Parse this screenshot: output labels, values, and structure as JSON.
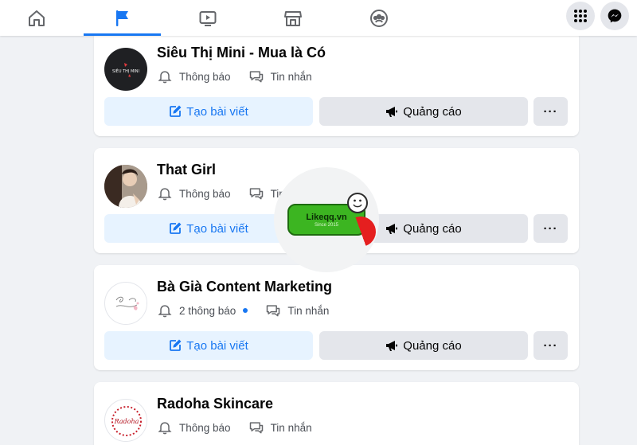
{
  "nav": {
    "tabs": [
      {
        "icon": "home-icon",
        "active": false
      },
      {
        "icon": "flag-icon",
        "active": true
      },
      {
        "icon": "video-icon",
        "active": false
      },
      {
        "icon": "marketplace-icon",
        "active": false
      },
      {
        "icon": "groups-icon",
        "active": false
      }
    ],
    "right": [
      {
        "icon": "menu-grid-icon"
      },
      {
        "icon": "messenger-icon"
      }
    ]
  },
  "colors": {
    "accent": "#1877f2",
    "create_bg": "#e7f3ff",
    "secondary_bg": "#e4e6eb",
    "page_bg": "#f0f2f5"
  },
  "pages": [
    {
      "name": "Siêu Thị Mini - Mua là Có",
      "avatar_text": "SIÊU THỊ MINI",
      "notifications": "Thông báo",
      "messages": "Tin nhắn",
      "has_dot": false,
      "create_label": "Tạo bài viết",
      "ads_label": "Quảng cáo",
      "more_label": "···"
    },
    {
      "name": "That Girl",
      "avatar_text": "",
      "notifications": "Thông báo",
      "messages": "Tin nhắn",
      "has_dot": false,
      "create_label": "Tạo bài viết",
      "ads_label": "Quảng cáo",
      "more_label": "···"
    },
    {
      "name": "Bà Già Content Marketing",
      "avatar_text": "",
      "notifications": "2 thông báo",
      "messages": "Tin nhắn",
      "has_dot": true,
      "create_label": "Tạo bài viết",
      "ads_label": "Quảng cáo",
      "more_label": "···"
    },
    {
      "name": "Radoha Skincare",
      "avatar_text": "Radoha",
      "notifications": "Thông báo",
      "messages": "Tin nhắn",
      "has_dot": false
    }
  ],
  "watermark": {
    "brand": "Likeqq.vn",
    "since": "Since 2015"
  }
}
